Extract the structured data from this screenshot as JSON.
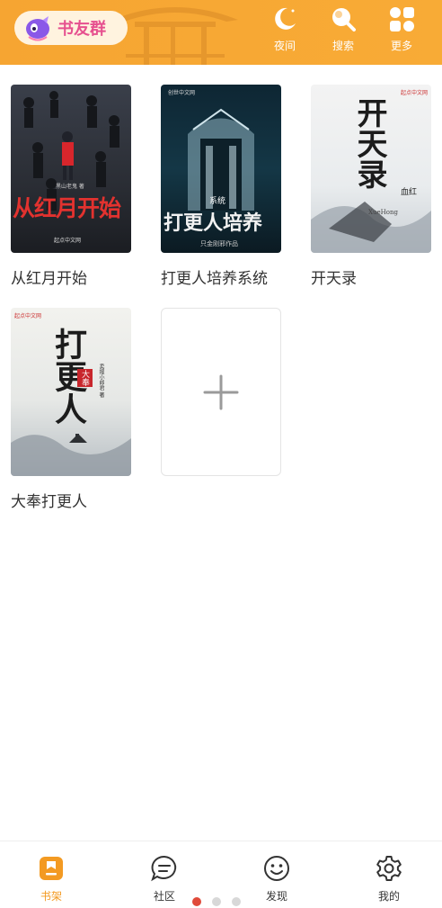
{
  "header": {
    "group_label": "书友群",
    "actions": [
      {
        "label": "夜间",
        "icon": "moon-icon"
      },
      {
        "label": "搜索",
        "icon": "search-icon"
      },
      {
        "label": "更多",
        "icon": "grid-more-icon"
      }
    ]
  },
  "books": [
    {
      "title": "从红月开始",
      "cover_text": "从红月开始",
      "cover_author": "黑山老鬼 著",
      "cover_publisher": "起点中文网"
    },
    {
      "title": "打更人培养系统",
      "cover_text": "打更人培养",
      "cover_tag": "系统",
      "cover_author": "只金刚邪作品",
      "cover_publisher": "创世中文网"
    },
    {
      "title": "开天录",
      "cover_text": "开天录",
      "cover_author": "血红",
      "cover_sub": "XueHong",
      "cover_publisher": "起点中文网"
    },
    {
      "title": "大奉打更人",
      "cover_text": "打更人",
      "cover_tag": "大奉",
      "cover_author": "卖报小郎君 著",
      "cover_publisher": "起点中文网"
    }
  ],
  "add_book_symbol": "+",
  "bottom_nav": [
    {
      "label": "书架",
      "icon": "bookshelf-icon",
      "active": true
    },
    {
      "label": "社区",
      "icon": "chat-icon",
      "active": false
    },
    {
      "label": "发现",
      "icon": "smile-icon",
      "active": false
    },
    {
      "label": "我的",
      "icon": "gear-icon",
      "active": false
    }
  ],
  "colors": {
    "header": "#f7a834",
    "accent": "#f39a22",
    "pill_text": "#e6508f",
    "pager_active": "#e04a3a"
  }
}
